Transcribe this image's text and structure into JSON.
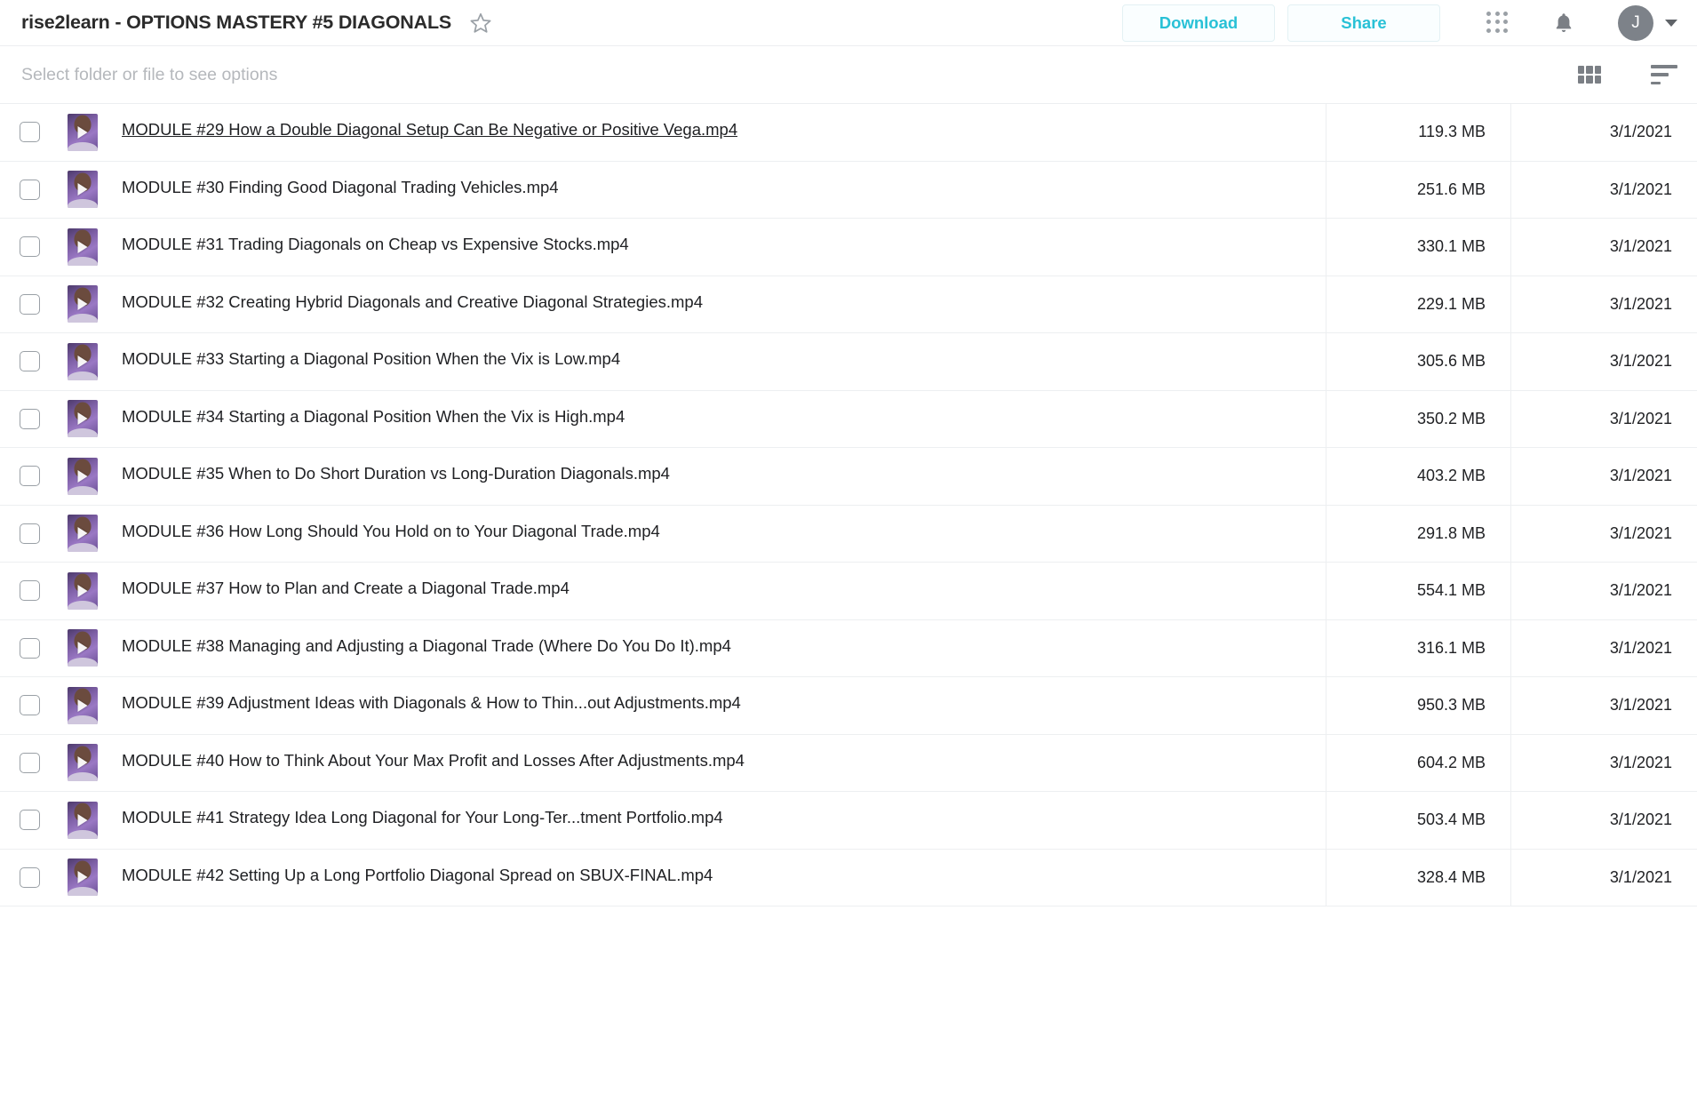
{
  "header": {
    "title": "rise2learn - OPTIONS MASTERY #5 DIAGONALS",
    "star_icon": "star-outline-icon",
    "download_label": "Download",
    "share_label": "Share",
    "apps_icon": "apps-grid-icon",
    "bell_icon": "notification-bell-icon",
    "avatar_initial": "J",
    "avatar_caret_icon": "chevron-down-icon",
    "accent_color": "#29c1d6"
  },
  "toolbar": {
    "hint": "Select folder or file to see options",
    "grid_view_icon": "grid-view-icon",
    "sort_icon": "sort-list-icon"
  },
  "files": [
    {
      "name": "MODULE #29 How a Double Diagonal Setup Can Be Negative or Positive Vega.mp4",
      "size": "119.3 MB",
      "date": "3/1/2021",
      "hovered": true
    },
    {
      "name": "MODULE #30 Finding Good Diagonal Trading Vehicles.mp4",
      "size": "251.6 MB",
      "date": "3/1/2021",
      "hovered": false
    },
    {
      "name": "MODULE #31 Trading Diagonals on Cheap vs Expensive Stocks.mp4",
      "size": "330.1 MB",
      "date": "3/1/2021",
      "hovered": false
    },
    {
      "name": "MODULE #32 Creating Hybrid Diagonals and Creative Diagonal Strategies.mp4",
      "size": "229.1 MB",
      "date": "3/1/2021",
      "hovered": false
    },
    {
      "name": "MODULE #33 Starting a Diagonal Position When the Vix is Low.mp4",
      "size": "305.6 MB",
      "date": "3/1/2021",
      "hovered": false
    },
    {
      "name": "MODULE #34 Starting a Diagonal Position When the Vix is High.mp4",
      "size": "350.2 MB",
      "date": "3/1/2021",
      "hovered": false
    },
    {
      "name": "MODULE #35 When to Do Short Duration vs Long-Duration Diagonals.mp4",
      "size": "403.2 MB",
      "date": "3/1/2021",
      "hovered": false
    },
    {
      "name": "MODULE #36 How Long Should You Hold on to Your Diagonal Trade.mp4",
      "size": "291.8 MB",
      "date": "3/1/2021",
      "hovered": false
    },
    {
      "name": "MODULE #37 How to Plan and Create a Diagonal Trade.mp4",
      "size": "554.1 MB",
      "date": "3/1/2021",
      "hovered": false
    },
    {
      "name": "MODULE #38 Managing and Adjusting a Diagonal Trade (Where Do You Do It).mp4",
      "size": "316.1 MB",
      "date": "3/1/2021",
      "hovered": false
    },
    {
      "name": "MODULE #39 Adjustment Ideas with Diagonals & How to Thin...out Adjustments.mp4",
      "size": "950.3 MB",
      "date": "3/1/2021",
      "hovered": false
    },
    {
      "name": "MODULE #40 How to Think About Your Max Profit and Losses After Adjustments.mp4",
      "size": "604.2 MB",
      "date": "3/1/2021",
      "hovered": false
    },
    {
      "name": "MODULE #41 Strategy Idea Long Diagonal for Your Long-Ter...tment Portfolio.mp4",
      "size": "503.4 MB",
      "date": "3/1/2021",
      "hovered": false
    },
    {
      "name": "MODULE #42 Setting Up a Long Portfolio Diagonal Spread on SBUX-FINAL.mp4",
      "size": "328.4 MB",
      "date": "3/1/2021",
      "hovered": false
    }
  ]
}
